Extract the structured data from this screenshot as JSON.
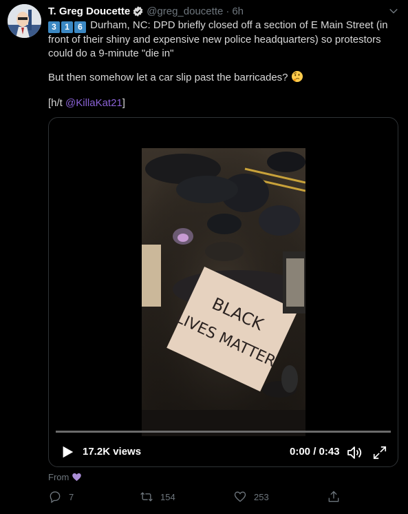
{
  "tweet": {
    "author_name": "T. Greg Doucette",
    "handle": "@greg_doucette",
    "separator": "·",
    "timestamp": "6h",
    "keycaps": [
      "3",
      "1",
      "6"
    ],
    "line1": "Durham, NC: DPD briefly closed off a section of E Main Street (in",
    "line2": "front of their shiny and expensive new police headquarters) so protestors",
    "line3": "could do a 9-minute \"die in\"",
    "line4": "But then somehow let a car slip past the barricades?",
    "ht_prefix": "[h/t ",
    "ht_mention": "@KillaKat21",
    "ht_suffix": "]"
  },
  "video": {
    "views": "17.2K views",
    "duration": "0:00 / 0:43",
    "sign_text_1": "BLACK",
    "sign_text_2": "LIVES MATTER",
    "progress": 0
  },
  "from_label": "From",
  "actions": {
    "reply_count": "7",
    "retweet_count": "154",
    "like_count": "253"
  },
  "colors": {
    "background": "#000000",
    "link": "#8a62d5",
    "muted": "#6e767d",
    "verified": "#d9d9d9"
  },
  "icons": [
    "verified-badge-icon",
    "chevron-down-icon",
    "keycap-digit-icon",
    "thinking-face-icon",
    "play-icon",
    "volume-icon",
    "fullscreen-icon",
    "purple-heart-icon",
    "reply-icon",
    "retweet-icon",
    "like-icon",
    "share-icon"
  ]
}
